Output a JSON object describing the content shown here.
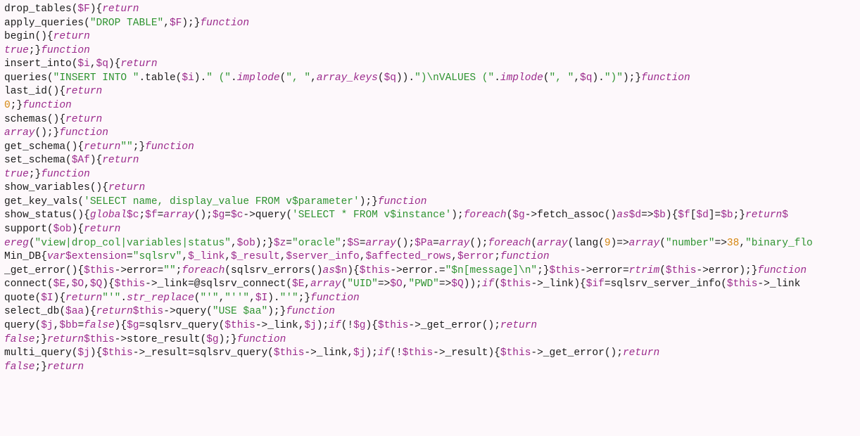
{
  "tokens": [
    [
      [
        "plain",
        "drop_tables("
      ],
      [
        "var",
        "$F"
      ],
      [
        "plain",
        "){"
      ],
      [
        "kw",
        "return"
      ]
    ],
    [
      [
        "plain",
        "apply_queries("
      ],
      [
        "str",
        "\"DROP TABLE\""
      ],
      [
        "plain",
        ","
      ],
      [
        "var",
        "$F"
      ],
      [
        "plain",
        ");}"
      ],
      [
        "kw",
        "function"
      ]
    ],
    [
      [
        "plain",
        "begin(){"
      ],
      [
        "kw",
        "return"
      ]
    ],
    [
      [
        "fn",
        "true"
      ],
      [
        "plain",
        ";}"
      ],
      [
        "kw",
        "function"
      ]
    ],
    [
      [
        "plain",
        "insert_into("
      ],
      [
        "var",
        "$i"
      ],
      [
        "plain",
        ","
      ],
      [
        "var",
        "$q"
      ],
      [
        "plain",
        "){"
      ],
      [
        "kw",
        "return"
      ]
    ],
    [
      [
        "plain",
        "queries("
      ],
      [
        "str",
        "\"INSERT INTO \""
      ],
      [
        "plain",
        ".table("
      ],
      [
        "var",
        "$i"
      ],
      [
        "plain",
        ")."
      ],
      [
        "str",
        "\" (\""
      ],
      [
        "plain",
        "."
      ],
      [
        "fn",
        "implode"
      ],
      [
        "plain",
        "("
      ],
      [
        "str",
        "\", \""
      ],
      [
        "plain",
        ","
      ],
      [
        "fn",
        "array_keys"
      ],
      [
        "plain",
        "("
      ],
      [
        "var",
        "$q"
      ],
      [
        "plain",
        "))."
      ],
      [
        "str",
        "\")\\nVALUES (\""
      ],
      [
        "plain",
        "."
      ],
      [
        "fn",
        "implode"
      ],
      [
        "plain",
        "("
      ],
      [
        "str",
        "\", \""
      ],
      [
        "plain",
        ","
      ],
      [
        "var",
        "$q"
      ],
      [
        "plain",
        ")."
      ],
      [
        "str",
        "\")\""
      ],
      [
        "plain",
        ");}"
      ],
      [
        "kw",
        "function"
      ]
    ],
    [
      [
        "plain",
        "last_id(){"
      ],
      [
        "kw",
        "return"
      ]
    ],
    [
      [
        "num",
        "0"
      ],
      [
        "plain",
        ";}"
      ],
      [
        "kw",
        "function"
      ]
    ],
    [
      [
        "plain",
        "schemas(){"
      ],
      [
        "kw",
        "return"
      ]
    ],
    [
      [
        "fn",
        "array"
      ],
      [
        "plain",
        "();}"
      ],
      [
        "kw",
        "function"
      ]
    ],
    [
      [
        "plain",
        "get_schema(){"
      ],
      [
        "kw",
        "return"
      ],
      [
        "str",
        "\"\""
      ],
      [
        "plain",
        ";}"
      ],
      [
        "kw",
        "function"
      ]
    ],
    [
      [
        "plain",
        "set_schema("
      ],
      [
        "var",
        "$Af"
      ],
      [
        "plain",
        "){"
      ],
      [
        "kw",
        "return"
      ]
    ],
    [
      [
        "fn",
        "true"
      ],
      [
        "plain",
        ";}"
      ],
      [
        "kw",
        "function"
      ]
    ],
    [
      [
        "plain",
        "show_variables(){"
      ],
      [
        "kw",
        "return"
      ]
    ],
    [
      [
        "plain",
        "get_key_vals("
      ],
      [
        "str",
        "'SELECT name, display_value FROM v$parameter'"
      ],
      [
        "plain",
        ");}"
      ],
      [
        "kw",
        "function"
      ]
    ],
    [
      [
        "plain",
        "show_status(){"
      ],
      [
        "kw",
        "global"
      ],
      [
        "var",
        "$c"
      ],
      [
        "plain",
        ";"
      ],
      [
        "var",
        "$f"
      ],
      [
        "plain",
        "="
      ],
      [
        "fn",
        "array"
      ],
      [
        "plain",
        "();"
      ],
      [
        "var",
        "$g"
      ],
      [
        "plain",
        "="
      ],
      [
        "var",
        "$c"
      ],
      [
        "plain",
        "->query("
      ],
      [
        "str",
        "'SELECT * FROM v$instance'"
      ],
      [
        "plain",
        ");"
      ],
      [
        "kw",
        "foreach"
      ],
      [
        "plain",
        "("
      ],
      [
        "var",
        "$g"
      ],
      [
        "plain",
        "->fetch_assoc()"
      ],
      [
        "kw",
        "as"
      ],
      [
        "var",
        "$d"
      ],
      [
        "plain",
        "=>"
      ],
      [
        "var",
        "$b"
      ],
      [
        "plain",
        "){"
      ],
      [
        "var",
        "$f"
      ],
      [
        "plain",
        "["
      ],
      [
        "var",
        "$d"
      ],
      [
        "plain",
        "]="
      ],
      [
        "var",
        "$b"
      ],
      [
        "plain",
        ";}"
      ],
      [
        "kw",
        "return"
      ],
      [
        "var",
        "$"
      ]
    ],
    [
      [
        "plain",
        "support("
      ],
      [
        "var",
        "$ob"
      ],
      [
        "plain",
        "){"
      ],
      [
        "kw",
        "return"
      ]
    ],
    [
      [
        "fn",
        "ereg"
      ],
      [
        "plain",
        "("
      ],
      [
        "str",
        "\"view|drop_col|variables|status\""
      ],
      [
        "plain",
        ","
      ],
      [
        "var",
        "$ob"
      ],
      [
        "plain",
        ");}"
      ],
      [
        "var",
        "$z"
      ],
      [
        "plain",
        "="
      ],
      [
        "str",
        "\"oracle\""
      ],
      [
        "plain",
        ";"
      ],
      [
        "var",
        "$S"
      ],
      [
        "plain",
        "="
      ],
      [
        "fn",
        "array"
      ],
      [
        "plain",
        "();"
      ],
      [
        "var",
        "$Pa"
      ],
      [
        "plain",
        "="
      ],
      [
        "fn",
        "array"
      ],
      [
        "plain",
        "();"
      ],
      [
        "kw",
        "foreach"
      ],
      [
        "plain",
        "("
      ],
      [
        "fn",
        "array"
      ],
      [
        "plain",
        "(lang("
      ],
      [
        "num",
        "9"
      ],
      [
        "plain",
        ")=>"
      ],
      [
        "fn",
        "array"
      ],
      [
        "plain",
        "("
      ],
      [
        "str",
        "\"number\""
      ],
      [
        "plain",
        "=>"
      ],
      [
        "num",
        "38"
      ],
      [
        "plain",
        ","
      ],
      [
        "str",
        "\"binary_flo"
      ]
    ],
    [
      [
        "plain",
        "Min_DB{"
      ],
      [
        "kw",
        "var"
      ],
      [
        "var",
        "$extension"
      ],
      [
        "plain",
        "="
      ],
      [
        "str",
        "\"sqlsrv\""
      ],
      [
        "plain",
        ","
      ],
      [
        "var",
        "$_link"
      ],
      [
        "plain",
        ","
      ],
      [
        "var",
        "$_result"
      ],
      [
        "plain",
        ","
      ],
      [
        "var",
        "$server_info"
      ],
      [
        "plain",
        ","
      ],
      [
        "var",
        "$affected_rows"
      ],
      [
        "plain",
        ","
      ],
      [
        "var",
        "$error"
      ],
      [
        "plain",
        ";"
      ],
      [
        "kw",
        "function"
      ]
    ],
    [
      [
        "plain",
        "_get_error(){"
      ],
      [
        "var",
        "$this"
      ],
      [
        "plain",
        "->error="
      ],
      [
        "str",
        "\"\""
      ],
      [
        "plain",
        ";"
      ],
      [
        "kw",
        "foreach"
      ],
      [
        "plain",
        "(sqlsrv_errors()"
      ],
      [
        "kw",
        "as"
      ],
      [
        "var",
        "$n"
      ],
      [
        "plain",
        "){"
      ],
      [
        "var",
        "$this"
      ],
      [
        "plain",
        "->error.="
      ],
      [
        "str",
        "\"$n[message]\\n\""
      ],
      [
        "plain",
        ";}"
      ],
      [
        "var",
        "$this"
      ],
      [
        "plain",
        "->error="
      ],
      [
        "fn",
        "rtrim"
      ],
      [
        "plain",
        "("
      ],
      [
        "var",
        "$this"
      ],
      [
        "plain",
        "->error);}"
      ],
      [
        "kw",
        "function"
      ]
    ],
    [
      [
        "plain",
        "connect("
      ],
      [
        "var",
        "$E"
      ],
      [
        "plain",
        ","
      ],
      [
        "var",
        "$O"
      ],
      [
        "plain",
        ","
      ],
      [
        "var",
        "$Q"
      ],
      [
        "plain",
        "){"
      ],
      [
        "var",
        "$this"
      ],
      [
        "plain",
        "->_link=@sqlsrv_connect("
      ],
      [
        "var",
        "$E"
      ],
      [
        "plain",
        ","
      ],
      [
        "fn",
        "array"
      ],
      [
        "plain",
        "("
      ],
      [
        "str",
        "\"UID\""
      ],
      [
        "plain",
        "=>"
      ],
      [
        "var",
        "$O"
      ],
      [
        "plain",
        ","
      ],
      [
        "str",
        "\"PWD\""
      ],
      [
        "plain",
        "=>"
      ],
      [
        "var",
        "$Q"
      ],
      [
        "plain",
        "));"
      ],
      [
        "kw",
        "if"
      ],
      [
        "plain",
        "("
      ],
      [
        "var",
        "$this"
      ],
      [
        "plain",
        "->_link){"
      ],
      [
        "var",
        "$if"
      ],
      [
        "plain",
        "=sqlsrv_server_info("
      ],
      [
        "var",
        "$this"
      ],
      [
        "plain",
        "->_link"
      ]
    ],
    [
      [
        "plain",
        "quote("
      ],
      [
        "var",
        "$I"
      ],
      [
        "plain",
        "){"
      ],
      [
        "kw",
        "return"
      ],
      [
        "str",
        "\"'\""
      ],
      [
        "plain",
        "."
      ],
      [
        "fn",
        "str_replace"
      ],
      [
        "plain",
        "("
      ],
      [
        "str",
        "\"'\""
      ],
      [
        "plain",
        ","
      ],
      [
        "str",
        "\"''\""
      ],
      [
        "plain",
        ","
      ],
      [
        "var",
        "$I"
      ],
      [
        "plain",
        ")."
      ],
      [
        "str",
        "\"'\""
      ],
      [
        "plain",
        ";}"
      ],
      [
        "kw",
        "function"
      ]
    ],
    [
      [
        "plain",
        "select_db("
      ],
      [
        "var",
        "$aa"
      ],
      [
        "plain",
        "){"
      ],
      [
        "kw",
        "return"
      ],
      [
        "var",
        "$this"
      ],
      [
        "plain",
        "->query("
      ],
      [
        "str",
        "\"USE $aa\""
      ],
      [
        "plain",
        ");}"
      ],
      [
        "kw",
        "function"
      ]
    ],
    [
      [
        "plain",
        "query("
      ],
      [
        "var",
        "$j"
      ],
      [
        "plain",
        ","
      ],
      [
        "var",
        "$bb"
      ],
      [
        "plain",
        "="
      ],
      [
        "fn",
        "false"
      ],
      [
        "plain",
        "){"
      ],
      [
        "var",
        "$g"
      ],
      [
        "plain",
        "=sqlsrv_query("
      ],
      [
        "var",
        "$this"
      ],
      [
        "plain",
        "->_link,"
      ],
      [
        "var",
        "$j"
      ],
      [
        "plain",
        ");"
      ],
      [
        "kw",
        "if"
      ],
      [
        "plain",
        "(!"
      ],
      [
        "var",
        "$g"
      ],
      [
        "plain",
        "){"
      ],
      [
        "var",
        "$this"
      ],
      [
        "plain",
        "->_get_error();"
      ],
      [
        "kw",
        "return"
      ]
    ],
    [
      [
        "fn",
        "false"
      ],
      [
        "plain",
        ";}"
      ],
      [
        "kw",
        "return"
      ],
      [
        "var",
        "$this"
      ],
      [
        "plain",
        "->store_result("
      ],
      [
        "var",
        "$g"
      ],
      [
        "plain",
        ");}"
      ],
      [
        "kw",
        "function"
      ]
    ],
    [
      [
        "plain",
        "multi_query("
      ],
      [
        "var",
        "$j"
      ],
      [
        "plain",
        "){"
      ],
      [
        "var",
        "$this"
      ],
      [
        "plain",
        "->_result=sqlsrv_query("
      ],
      [
        "var",
        "$this"
      ],
      [
        "plain",
        "->_link,"
      ],
      [
        "var",
        "$j"
      ],
      [
        "plain",
        ");"
      ],
      [
        "kw",
        "if"
      ],
      [
        "plain",
        "(!"
      ],
      [
        "var",
        "$this"
      ],
      [
        "plain",
        "->_result){"
      ],
      [
        "var",
        "$this"
      ],
      [
        "plain",
        "->_get_error();"
      ],
      [
        "kw",
        "return"
      ]
    ],
    [
      [
        "fn",
        "false"
      ],
      [
        "plain",
        ";}"
      ],
      [
        "kw",
        "return"
      ]
    ]
  ]
}
